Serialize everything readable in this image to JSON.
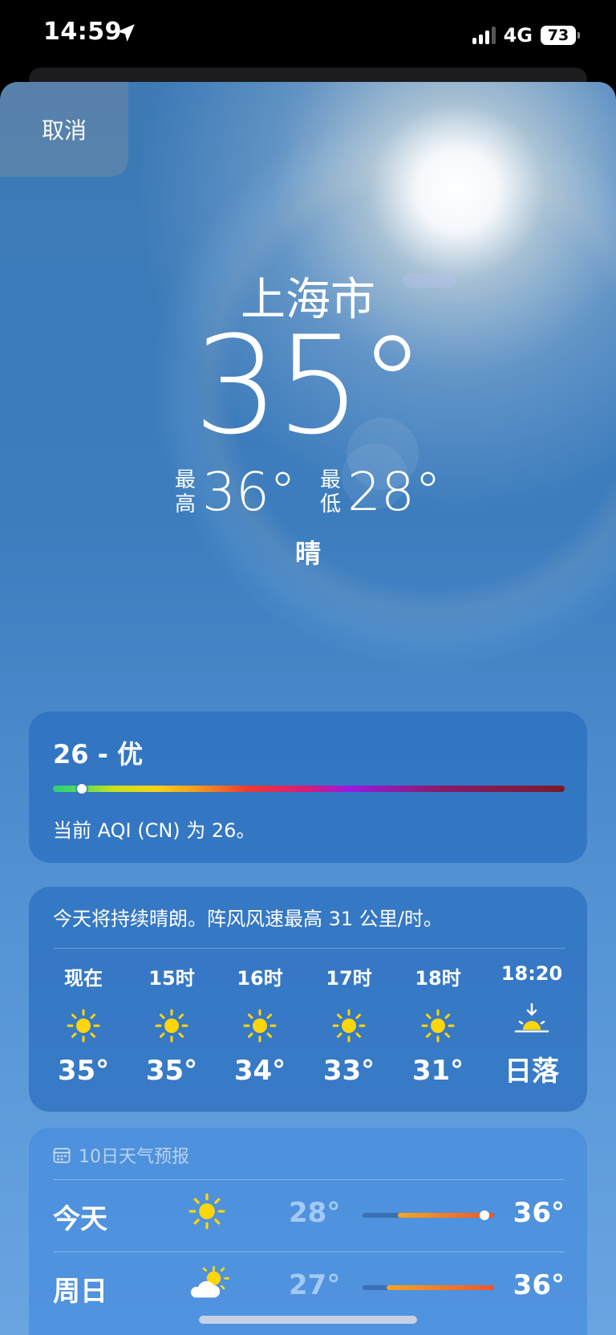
{
  "status_bar": {
    "time": "14:59",
    "network": "4G",
    "battery": "73"
  },
  "sheet": {
    "cancel_label": "取消"
  },
  "current": {
    "city": "上海市",
    "temperature": "35°",
    "high_label_1": "最",
    "high_label_2": "高",
    "high": "36°",
    "low_label_1": "最",
    "low_label_2": "低",
    "low": "28°",
    "condition": "晴"
  },
  "aqi": {
    "value_text": "26 - 优",
    "index_value": 26,
    "description": "当前 AQI (CN) 为 26。"
  },
  "hourly": {
    "summary": "今天将持续晴朗。阵风风速最高 31 公里/时。",
    "items": [
      {
        "label": "现在",
        "icon": "sun-icon",
        "value": "35°"
      },
      {
        "label": "15时",
        "icon": "sun-icon",
        "value": "35°"
      },
      {
        "label": "16时",
        "icon": "sun-icon",
        "value": "34°"
      },
      {
        "label": "17时",
        "icon": "sun-icon",
        "value": "33°"
      },
      {
        "label": "18时",
        "icon": "sun-icon",
        "value": "31°"
      },
      {
        "label": "18:20",
        "icon": "sunset-icon",
        "value": "日落"
      }
    ]
  },
  "daily": {
    "title": "10日天气预报",
    "rows": [
      {
        "day": "今天",
        "icon": "sun-icon",
        "low": "28°",
        "high": "36°"
      },
      {
        "day": "周日",
        "icon": "partly-cloudy-icon",
        "low": "27°",
        "high": "36°"
      }
    ]
  },
  "colors": {
    "sun_yellow": "#FFD60A",
    "range_bar": "#F0542A",
    "sheet_blue": "#3D7DBE"
  }
}
